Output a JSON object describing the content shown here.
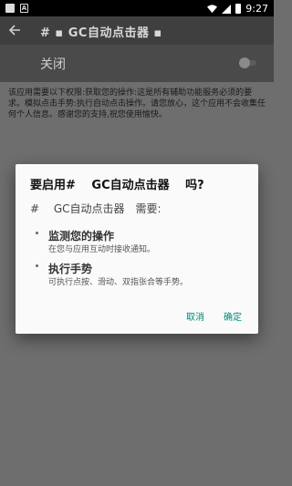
{
  "status_bar": {
    "icons": [
      "image-notification-icon",
      "a-notification-icon",
      "wifi-icon",
      "signal-icon",
      "battery-icon"
    ],
    "time": "9:27"
  },
  "toolbar": {
    "title": "# ▪ GC自动点击器 ▪"
  },
  "switch_row": {
    "label": "关闭",
    "checked": false
  },
  "description": "该应用需要以下权限:获取您的操作:这是所有辅助功能服务必须的要求。模拟点击手势:执行自动点击操作。请您放心，这个应用不会收集任何个人信息。感谢您的支持,祝您使用愉快。",
  "dialog": {
    "title": "要启用#　 GC自动点击器　 吗?",
    "subtitle": "#　 GC自动点击器　需要:",
    "permissions": [
      {
        "title": "监测您的操作",
        "desc": "在您与应用互动时接收通知。"
      },
      {
        "title": "执行手势",
        "desc": "可执行点按、滑动、双指张合等手势。"
      }
    ],
    "cancel_label": "取消",
    "ok_label": "确定",
    "accent_color": "#00897b"
  }
}
